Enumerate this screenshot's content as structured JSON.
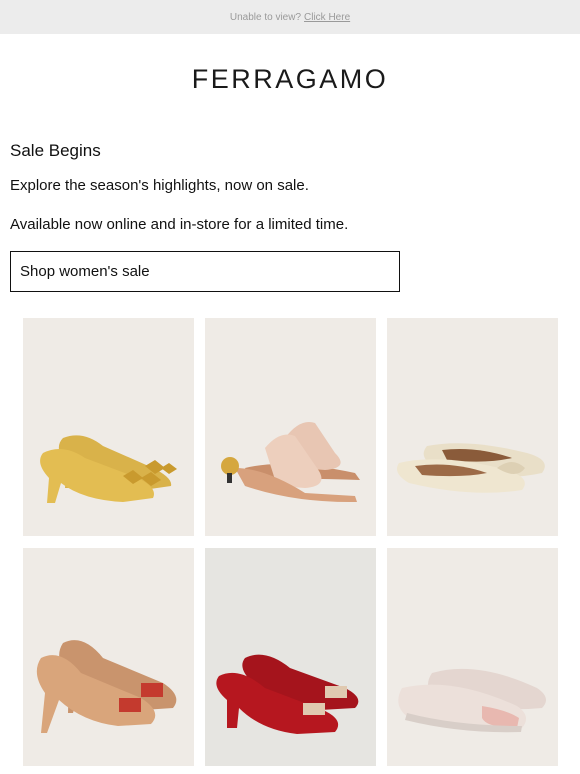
{
  "topbar": {
    "text": "Unable to view?",
    "link": "Click Here"
  },
  "brand": {
    "logo": "FERRAGAMO"
  },
  "main": {
    "headline": "Sale Begins",
    "intro": "Explore the season's highlights, now on sale.",
    "availability": "Available now online and in-store for a limited time.",
    "cta_label": "Shop women's sale"
  },
  "products": [
    {
      "icon": "gold-bow-pump-icon",
      "bg": "#efebe6"
    },
    {
      "icon": "pink-strap-sandal-icon",
      "bg": "#efebe6"
    },
    {
      "icon": "cream-ballet-flat-icon",
      "bg": "#efebe6"
    },
    {
      "icon": "tan-bow-heel-icon",
      "bg": "#efebe6"
    },
    {
      "icon": "red-patent-pump-icon",
      "bg": "#e6e5e1"
    },
    {
      "icon": "pink-sneaker-icon",
      "bg": "#efebe6"
    }
  ]
}
